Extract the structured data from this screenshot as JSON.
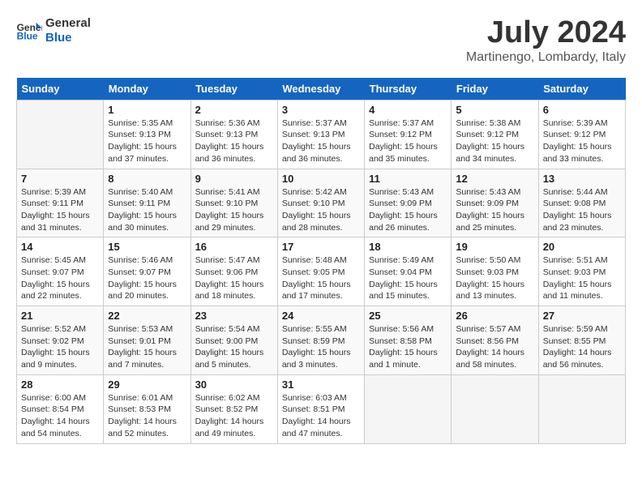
{
  "header": {
    "logo_line1": "General",
    "logo_line2": "Blue",
    "month_year": "July 2024",
    "location": "Martinengo, Lombardy, Italy"
  },
  "weekdays": [
    "Sunday",
    "Monday",
    "Tuesday",
    "Wednesday",
    "Thursday",
    "Friday",
    "Saturday"
  ],
  "weeks": [
    [
      {
        "day": "",
        "sunrise": "",
        "sunset": "",
        "daylight": ""
      },
      {
        "day": "1",
        "sunrise": "Sunrise: 5:35 AM",
        "sunset": "Sunset: 9:13 PM",
        "daylight": "Daylight: 15 hours and 37 minutes."
      },
      {
        "day": "2",
        "sunrise": "Sunrise: 5:36 AM",
        "sunset": "Sunset: 9:13 PM",
        "daylight": "Daylight: 15 hours and 36 minutes."
      },
      {
        "day": "3",
        "sunrise": "Sunrise: 5:37 AM",
        "sunset": "Sunset: 9:13 PM",
        "daylight": "Daylight: 15 hours and 36 minutes."
      },
      {
        "day": "4",
        "sunrise": "Sunrise: 5:37 AM",
        "sunset": "Sunset: 9:12 PM",
        "daylight": "Daylight: 15 hours and 35 minutes."
      },
      {
        "day": "5",
        "sunrise": "Sunrise: 5:38 AM",
        "sunset": "Sunset: 9:12 PM",
        "daylight": "Daylight: 15 hours and 34 minutes."
      },
      {
        "day": "6",
        "sunrise": "Sunrise: 5:39 AM",
        "sunset": "Sunset: 9:12 PM",
        "daylight": "Daylight: 15 hours and 33 minutes."
      }
    ],
    [
      {
        "day": "7",
        "sunrise": "Sunrise: 5:39 AM",
        "sunset": "Sunset: 9:11 PM",
        "daylight": "Daylight: 15 hours and 31 minutes."
      },
      {
        "day": "8",
        "sunrise": "Sunrise: 5:40 AM",
        "sunset": "Sunset: 9:11 PM",
        "daylight": "Daylight: 15 hours and 30 minutes."
      },
      {
        "day": "9",
        "sunrise": "Sunrise: 5:41 AM",
        "sunset": "Sunset: 9:10 PM",
        "daylight": "Daylight: 15 hours and 29 minutes."
      },
      {
        "day": "10",
        "sunrise": "Sunrise: 5:42 AM",
        "sunset": "Sunset: 9:10 PM",
        "daylight": "Daylight: 15 hours and 28 minutes."
      },
      {
        "day": "11",
        "sunrise": "Sunrise: 5:43 AM",
        "sunset": "Sunset: 9:09 PM",
        "daylight": "Daylight: 15 hours and 26 minutes."
      },
      {
        "day": "12",
        "sunrise": "Sunrise: 5:43 AM",
        "sunset": "Sunset: 9:09 PM",
        "daylight": "Daylight: 15 hours and 25 minutes."
      },
      {
        "day": "13",
        "sunrise": "Sunrise: 5:44 AM",
        "sunset": "Sunset: 9:08 PM",
        "daylight": "Daylight: 15 hours and 23 minutes."
      }
    ],
    [
      {
        "day": "14",
        "sunrise": "Sunrise: 5:45 AM",
        "sunset": "Sunset: 9:07 PM",
        "daylight": "Daylight: 15 hours and 22 minutes."
      },
      {
        "day": "15",
        "sunrise": "Sunrise: 5:46 AM",
        "sunset": "Sunset: 9:07 PM",
        "daylight": "Daylight: 15 hours and 20 minutes."
      },
      {
        "day": "16",
        "sunrise": "Sunrise: 5:47 AM",
        "sunset": "Sunset: 9:06 PM",
        "daylight": "Daylight: 15 hours and 18 minutes."
      },
      {
        "day": "17",
        "sunrise": "Sunrise: 5:48 AM",
        "sunset": "Sunset: 9:05 PM",
        "daylight": "Daylight: 15 hours and 17 minutes."
      },
      {
        "day": "18",
        "sunrise": "Sunrise: 5:49 AM",
        "sunset": "Sunset: 9:04 PM",
        "daylight": "Daylight: 15 hours and 15 minutes."
      },
      {
        "day": "19",
        "sunrise": "Sunrise: 5:50 AM",
        "sunset": "Sunset: 9:03 PM",
        "daylight": "Daylight: 15 hours and 13 minutes."
      },
      {
        "day": "20",
        "sunrise": "Sunrise: 5:51 AM",
        "sunset": "Sunset: 9:03 PM",
        "daylight": "Daylight: 15 hours and 11 minutes."
      }
    ],
    [
      {
        "day": "21",
        "sunrise": "Sunrise: 5:52 AM",
        "sunset": "Sunset: 9:02 PM",
        "daylight": "Daylight: 15 hours and 9 minutes."
      },
      {
        "day": "22",
        "sunrise": "Sunrise: 5:53 AM",
        "sunset": "Sunset: 9:01 PM",
        "daylight": "Daylight: 15 hours and 7 minutes."
      },
      {
        "day": "23",
        "sunrise": "Sunrise: 5:54 AM",
        "sunset": "Sunset: 9:00 PM",
        "daylight": "Daylight: 15 hours and 5 minutes."
      },
      {
        "day": "24",
        "sunrise": "Sunrise: 5:55 AM",
        "sunset": "Sunset: 8:59 PM",
        "daylight": "Daylight: 15 hours and 3 minutes."
      },
      {
        "day": "25",
        "sunrise": "Sunrise: 5:56 AM",
        "sunset": "Sunset: 8:58 PM",
        "daylight": "Daylight: 15 hours and 1 minute."
      },
      {
        "day": "26",
        "sunrise": "Sunrise: 5:57 AM",
        "sunset": "Sunset: 8:56 PM",
        "daylight": "Daylight: 14 hours and 58 minutes."
      },
      {
        "day": "27",
        "sunrise": "Sunrise: 5:59 AM",
        "sunset": "Sunset: 8:55 PM",
        "daylight": "Daylight: 14 hours and 56 minutes."
      }
    ],
    [
      {
        "day": "28",
        "sunrise": "Sunrise: 6:00 AM",
        "sunset": "Sunset: 8:54 PM",
        "daylight": "Daylight: 14 hours and 54 minutes."
      },
      {
        "day": "29",
        "sunrise": "Sunrise: 6:01 AM",
        "sunset": "Sunset: 8:53 PM",
        "daylight": "Daylight: 14 hours and 52 minutes."
      },
      {
        "day": "30",
        "sunrise": "Sunrise: 6:02 AM",
        "sunset": "Sunset: 8:52 PM",
        "daylight": "Daylight: 14 hours and 49 minutes."
      },
      {
        "day": "31",
        "sunrise": "Sunrise: 6:03 AM",
        "sunset": "Sunset: 8:51 PM",
        "daylight": "Daylight: 14 hours and 47 minutes."
      },
      {
        "day": "",
        "sunrise": "",
        "sunset": "",
        "daylight": ""
      },
      {
        "day": "",
        "sunrise": "",
        "sunset": "",
        "daylight": ""
      },
      {
        "day": "",
        "sunrise": "",
        "sunset": "",
        "daylight": ""
      }
    ]
  ]
}
